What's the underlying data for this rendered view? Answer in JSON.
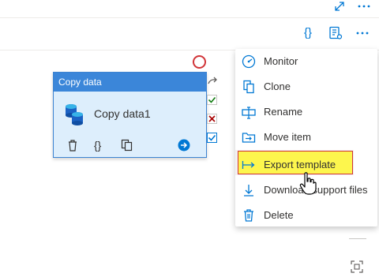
{
  "topbar": {
    "expand_icon": "expand-icon",
    "more_icon": "more-icon"
  },
  "toolbar": {
    "code_icon": "{}",
    "properties_icon": "properties-icon",
    "more_icon": "more-icon"
  },
  "activity": {
    "header": "Copy data",
    "name": "Copy data1",
    "actions": [
      "delete-icon",
      "code-icon",
      "copy-icon",
      "go-icon"
    ]
  },
  "menu": {
    "items": [
      {
        "label": "Monitor",
        "icon": "monitor-icon"
      },
      {
        "label": "Clone",
        "icon": "clone-icon"
      },
      {
        "label": "Rename",
        "icon": "rename-icon"
      },
      {
        "label": "Move item",
        "icon": "move-item-icon"
      },
      {
        "label": "Export template",
        "icon": "export-icon"
      },
      {
        "label": "Download support files",
        "icon": "download-icon"
      },
      {
        "label": "Delete",
        "icon": "delete-icon"
      }
    ]
  },
  "colors": {
    "accent": "#0078d4",
    "highlight": "#fdf64d",
    "danger": "#d13438",
    "success": "#107c10"
  }
}
